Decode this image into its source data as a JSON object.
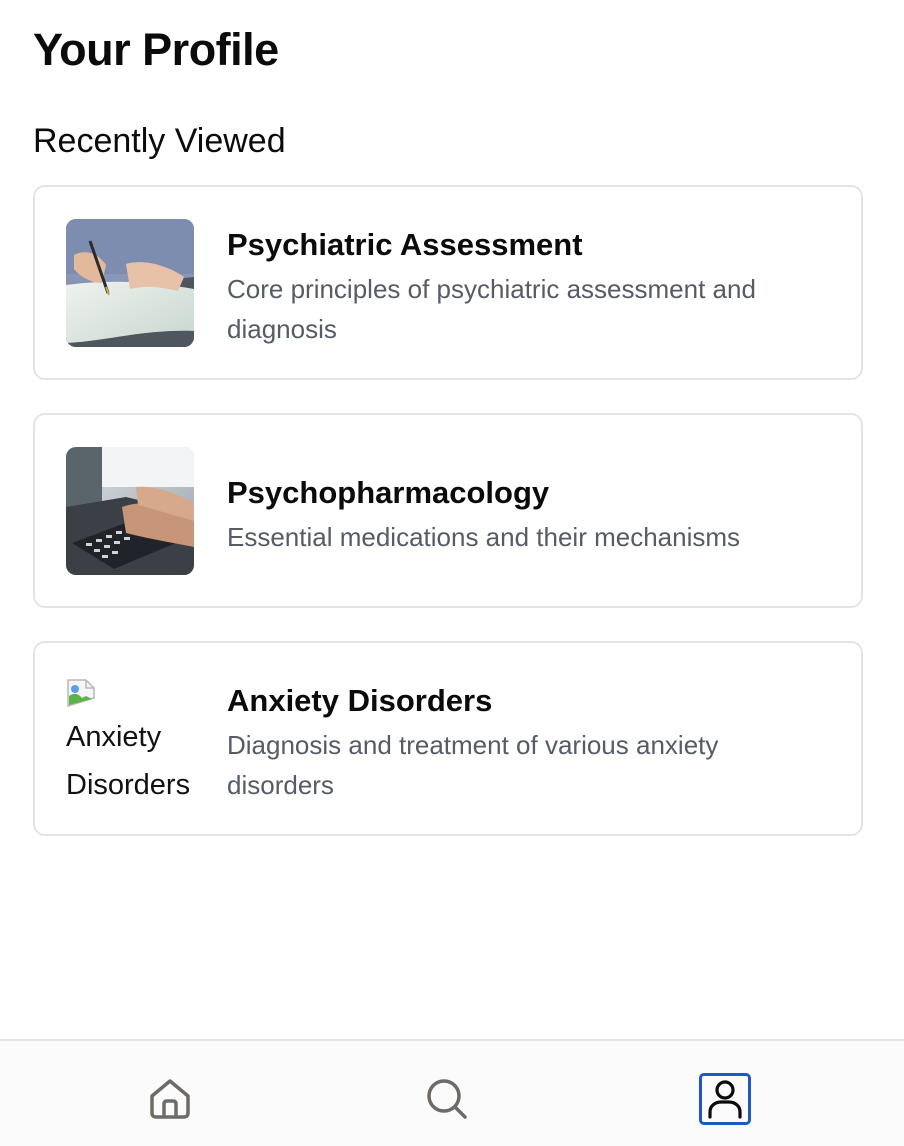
{
  "header": {
    "title": "Your Profile"
  },
  "recently_viewed": {
    "heading": "Recently Viewed",
    "items": [
      {
        "title": "Psychiatric Assessment",
        "description": "Core principles of psychiatric assessment and diagnosis",
        "image": "writing-on-paper-photo"
      },
      {
        "title": "Psychopharmacology",
        "description": "Essential medications and their mechanisms",
        "image": "typing-on-laptop-photo"
      },
      {
        "title": "Anxiety Disorders",
        "description": "Diagnosis and treatment of various anxiety disorders",
        "image": "broken-image-icon",
        "image_alt": "Anxiety Disorders"
      }
    ]
  },
  "bottom_nav": {
    "items": [
      {
        "icon": "home-icon",
        "active": false
      },
      {
        "icon": "search-icon",
        "active": false
      },
      {
        "icon": "profile-icon",
        "active": true
      }
    ],
    "active_color": "#1f57c3",
    "inactive_color": "#6e6a66"
  }
}
